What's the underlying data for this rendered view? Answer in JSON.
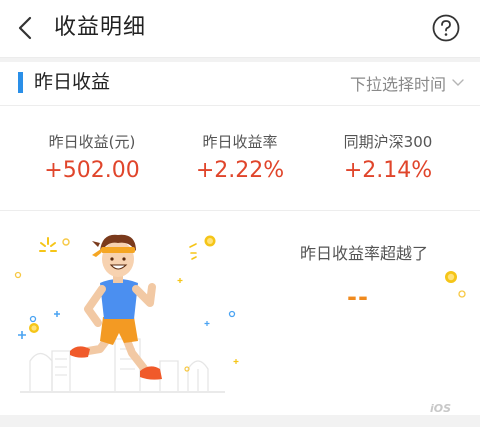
{
  "header": {
    "title": "收益明细",
    "back_icon": "chevron-left-icon",
    "help_icon": "question-circle-icon"
  },
  "section": {
    "title": "昨日收益",
    "time_picker_label": "下拉选择时间",
    "accent_color": "#2a8fe8"
  },
  "stats": [
    {
      "label": "昨日收益(元)",
      "value": "+502.00"
    },
    {
      "label": "昨日收益率",
      "value": "+2.22%"
    },
    {
      "label": "同期沪深300",
      "value": "+2.14%"
    }
  ],
  "beat": {
    "label": "昨日收益率超越了",
    "value": "--"
  },
  "watermark": "iOS",
  "colors": {
    "gain": "#e0452b",
    "beat": "#f08a1e",
    "coin": "#f5c518"
  }
}
